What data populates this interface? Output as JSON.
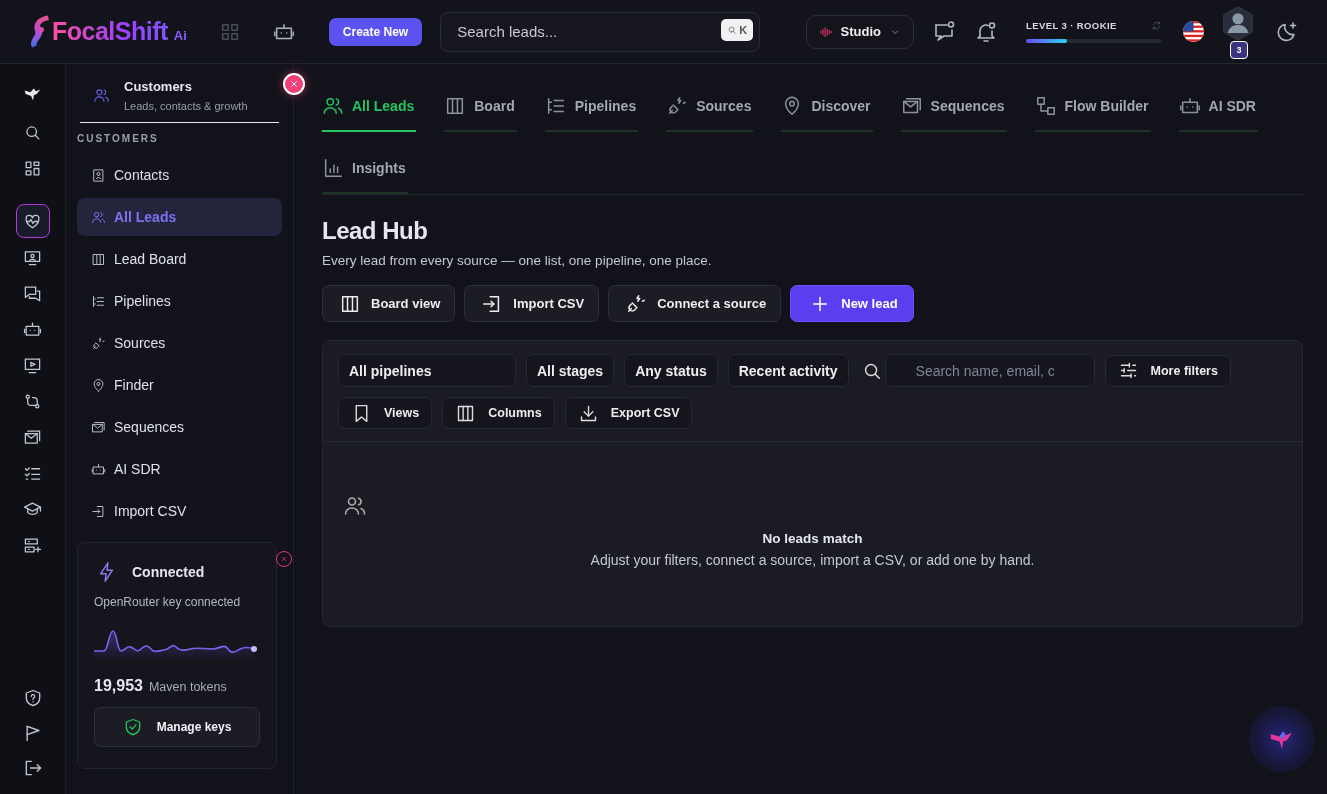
{
  "brand": {
    "name": "FocalShift",
    "suffix": "Ai"
  },
  "topbar": {
    "create_button": "Create New",
    "search": {
      "placeholder": "Search leads...",
      "shortcut": "K"
    },
    "workspace": "Studio",
    "level": {
      "label": "LEVEL 3 · ROOKIE",
      "level": 0.3
    },
    "avatar_badge": "3"
  },
  "rail": [
    {
      "selected": false
    },
    {
      "selected": false
    },
    {
      "selected": true
    },
    {
      "selected": false
    },
    {
      "selected": false
    },
    {
      "selected": false
    },
    {
      "selected": false
    },
    {
      "selected": false
    },
    {
      "selected": false
    },
    {
      "selected": false
    },
    {
      "selected": false
    },
    {
      "selected": false
    }
  ],
  "sidebar": {
    "title": "Customers",
    "subtitle": "Leads, contacts & growth",
    "section": "CUSTOMERS",
    "items": [
      {
        "label": "Contacts",
        "selected": false
      },
      {
        "label": "All Leads",
        "selected": true
      },
      {
        "label": "Lead Board",
        "selected": false
      },
      {
        "label": "Pipelines",
        "selected": false
      },
      {
        "label": "Sources",
        "selected": false
      },
      {
        "label": "Finder",
        "selected": false
      },
      {
        "label": "Sequences",
        "selected": false
      },
      {
        "label": "AI SDR",
        "selected": false
      },
      {
        "label": "Import CSV",
        "selected": false
      }
    ]
  },
  "key_card": {
    "status": "Connected",
    "detail": "OpenRouter key connected",
    "tokens": "19,953",
    "tokens_label": "Maven tokens",
    "button": "Manage keys"
  },
  "tabs": [
    {
      "label": "All Leads",
      "selected": true
    },
    {
      "label": "Board",
      "selected": false
    },
    {
      "label": "Pipelines",
      "selected": false
    },
    {
      "label": "Sources",
      "selected": false
    },
    {
      "label": "Discover",
      "selected": false
    },
    {
      "label": "Sequences",
      "selected": false
    },
    {
      "label": "Flow Builder",
      "selected": false
    },
    {
      "label": "AI SDR",
      "selected": false
    },
    {
      "label": "Insights",
      "selected": false
    }
  ],
  "page": {
    "title": "Lead Hub",
    "subtitle": "Every lead from every source — one list, one pipeline, one place.",
    "actions": [
      {
        "label": "Board view",
        "kind": "secondary"
      },
      {
        "label": "Import CSV",
        "kind": "secondary"
      },
      {
        "label": "Connect a source",
        "kind": "secondary"
      },
      {
        "label": "New lead",
        "kind": "primary"
      }
    ]
  },
  "filters": {
    "selects": [
      {
        "label": "All pipelines",
        "kind": "wide"
      },
      {
        "label": "All stages",
        "kind": "plain"
      },
      {
        "label": "Any status",
        "kind": "plain"
      },
      {
        "label": "Recent activity",
        "kind": "plain"
      }
    ],
    "search": {
      "placeholder": "Search name, email, c"
    },
    "more_filters": "More filters",
    "tools": [
      "Views",
      "Columns",
      "Export CSV"
    ]
  },
  "empty_state": {
    "title": "No leads match",
    "message": "Adjust your filters, connect a source, import a CSV, or add one by hand."
  }
}
